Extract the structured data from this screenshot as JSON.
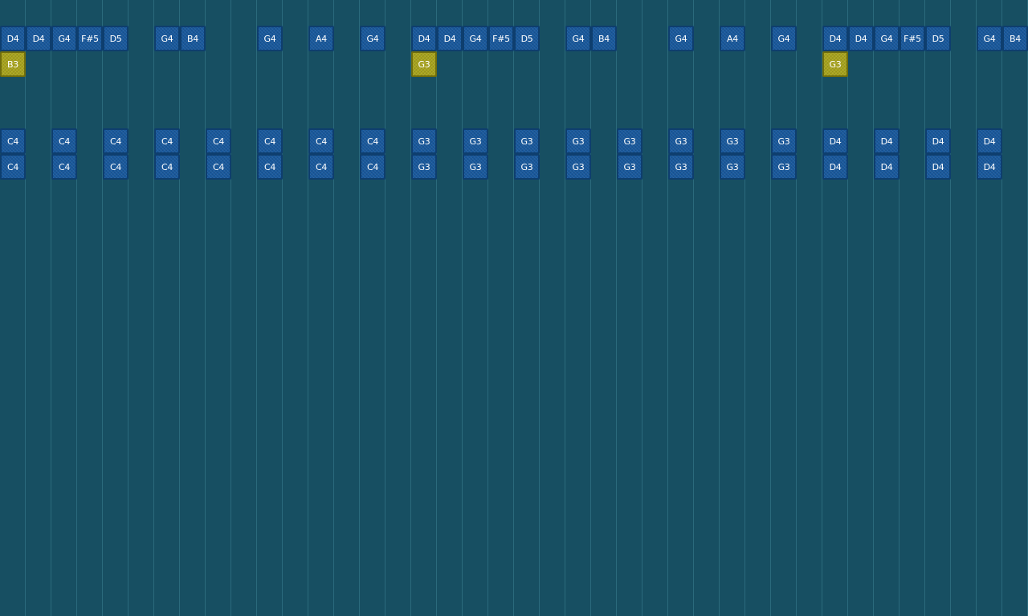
{
  "colors": {
    "background": "#174f62",
    "gridline": "#2b6a7c",
    "note": "#18589c",
    "note_border": "#0e3e6e",
    "note_selected": "#a8a41c",
    "note_selected_border": "#6f6d0c"
  },
  "note_rows": [
    {
      "row": "melody",
      "notes": [
        {
          "col": 0,
          "label": "D4"
        },
        {
          "col": 1,
          "label": "D4"
        },
        {
          "col": 2,
          "label": "G4"
        },
        {
          "col": 3,
          "label": "F#5"
        },
        {
          "col": 4,
          "label": "D5"
        },
        {
          "col": 6,
          "label": "G4"
        },
        {
          "col": 7,
          "label": "B4"
        },
        {
          "col": 10,
          "label": "G4"
        },
        {
          "col": 12,
          "label": "A4"
        },
        {
          "col": 14,
          "label": "G4"
        },
        {
          "col": 16,
          "label": "D4"
        },
        {
          "col": 17,
          "label": "D4"
        },
        {
          "col": 18,
          "label": "G4"
        },
        {
          "col": 19,
          "label": "F#5"
        },
        {
          "col": 20,
          "label": "D5"
        },
        {
          "col": 22,
          "label": "G4"
        },
        {
          "col": 23,
          "label": "B4"
        },
        {
          "col": 26,
          "label": "G4"
        },
        {
          "col": 28,
          "label": "A4"
        },
        {
          "col": 30,
          "label": "G4"
        },
        {
          "col": 32,
          "label": "D4"
        },
        {
          "col": 33,
          "label": "D4"
        },
        {
          "col": 34,
          "label": "G4"
        },
        {
          "col": 35,
          "label": "F#5"
        },
        {
          "col": 36,
          "label": "D5"
        },
        {
          "col": 38,
          "label": "G4"
        },
        {
          "col": 39,
          "label": "B4"
        }
      ]
    },
    {
      "row": "harmony",
      "notes": [
        {
          "col": 0,
          "label": "B3",
          "selected": true
        },
        {
          "col": 16,
          "label": "G3",
          "selected": true
        },
        {
          "col": 32,
          "label": "G3",
          "selected": true
        }
      ]
    },
    {
      "row": "bass-upper",
      "notes": [
        {
          "col": 0,
          "label": "C4"
        },
        {
          "col": 2,
          "label": "C4"
        },
        {
          "col": 4,
          "label": "C4"
        },
        {
          "col": 6,
          "label": "C4"
        },
        {
          "col": 8,
          "label": "C4"
        },
        {
          "col": 10,
          "label": "C4"
        },
        {
          "col": 12,
          "label": "C4"
        },
        {
          "col": 14,
          "label": "C4"
        },
        {
          "col": 16,
          "label": "G3"
        },
        {
          "col": 18,
          "label": "G3"
        },
        {
          "col": 20,
          "label": "G3"
        },
        {
          "col": 22,
          "label": "G3"
        },
        {
          "col": 24,
          "label": "G3"
        },
        {
          "col": 26,
          "label": "G3"
        },
        {
          "col": 28,
          "label": "G3"
        },
        {
          "col": 30,
          "label": "G3"
        },
        {
          "col": 32,
          "label": "D4"
        },
        {
          "col": 34,
          "label": "D4"
        },
        {
          "col": 36,
          "label": "D4"
        },
        {
          "col": 38,
          "label": "D4"
        }
      ]
    },
    {
      "row": "bass-lower",
      "notes": [
        {
          "col": 0,
          "label": "C4"
        },
        {
          "col": 2,
          "label": "C4"
        },
        {
          "col": 4,
          "label": "C4"
        },
        {
          "col": 6,
          "label": "C4"
        },
        {
          "col": 8,
          "label": "C4"
        },
        {
          "col": 10,
          "label": "C4"
        },
        {
          "col": 12,
          "label": "C4"
        },
        {
          "col": 14,
          "label": "C4"
        },
        {
          "col": 16,
          "label": "G3"
        },
        {
          "col": 18,
          "label": "G3"
        },
        {
          "col": 20,
          "label": "G3"
        },
        {
          "col": 22,
          "label": "G3"
        },
        {
          "col": 24,
          "label": "G3"
        },
        {
          "col": 26,
          "label": "G3"
        },
        {
          "col": 28,
          "label": "G3"
        },
        {
          "col": 30,
          "label": "G3"
        },
        {
          "col": 32,
          "label": "D4"
        },
        {
          "col": 34,
          "label": "D4"
        },
        {
          "col": 36,
          "label": "D4"
        },
        {
          "col": 38,
          "label": "D4"
        }
      ]
    }
  ]
}
